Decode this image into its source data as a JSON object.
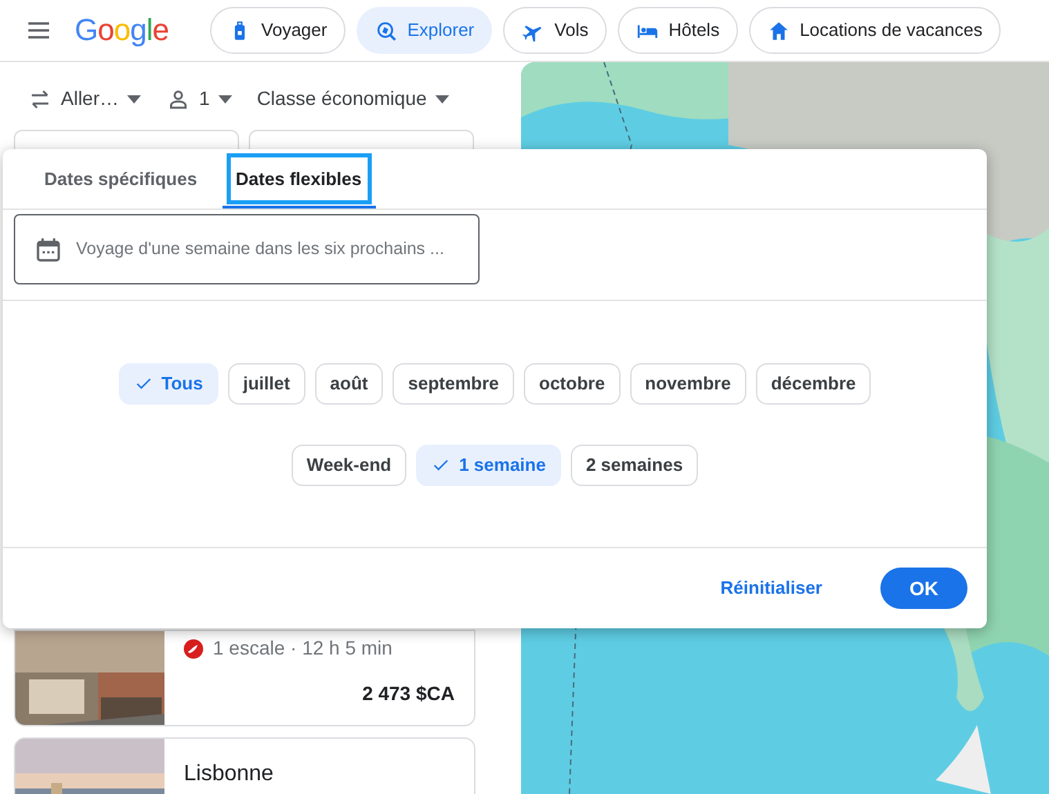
{
  "header": {
    "logo": "Google",
    "tabs": [
      {
        "label": "Voyager",
        "selected": false
      },
      {
        "label": "Explorer",
        "selected": true
      },
      {
        "label": "Vols",
        "selected": false
      },
      {
        "label": "Hôtels",
        "selected": false
      },
      {
        "label": "Locations de vacances",
        "selected": false
      }
    ]
  },
  "search_options": {
    "trip_type": "Aller…",
    "passengers": "1",
    "cabin_class": "Classe économique"
  },
  "results": [
    {
      "stops": "1 escale · 12 h 5 min",
      "price": "2 473 $CA"
    },
    {
      "city": "Lisbonne"
    }
  ],
  "dialog": {
    "tabs": [
      {
        "label": "Dates spécifiques",
        "selected": false
      },
      {
        "label": "Dates flexibles",
        "selected": true
      }
    ],
    "field": {
      "value": "Voyage d'une semaine dans les six prochains ..."
    },
    "months": [
      {
        "label": "Tous",
        "selected": true
      },
      {
        "label": "juillet",
        "selected": false
      },
      {
        "label": "août",
        "selected": false
      },
      {
        "label": "septembre",
        "selected": false
      },
      {
        "label": "octobre",
        "selected": false
      },
      {
        "label": "novembre",
        "selected": false
      },
      {
        "label": "décembre",
        "selected": false
      }
    ],
    "durations": [
      {
        "label": "Week-end",
        "selected": false
      },
      {
        "label": "1 semaine",
        "selected": true
      },
      {
        "label": "2 semaines",
        "selected": false
      }
    ],
    "reset": "Réinitialiser",
    "ok": "OK"
  }
}
